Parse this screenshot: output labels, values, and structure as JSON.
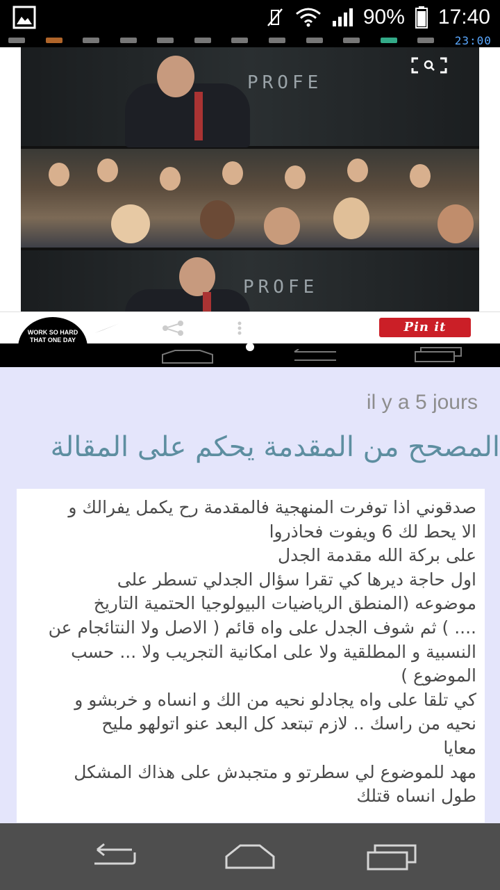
{
  "status_bar": {
    "battery": "90%",
    "time": "17:40"
  },
  "embedded_screenshot": {
    "inner_time": "23:00",
    "chalkboard_text_top": "PROFE",
    "chalkboard_text_bottom": "PROFE",
    "pin_label": "Pin it",
    "avatar_text": "WORK SO HARD THAT ONE DAY YOUR SIGNATURE WILL BE CALLED AN AUTOGRAPH.\""
  },
  "post": {
    "timestamp": "il y a 5 jours",
    "title": "المصحح من المقدمة يحكم على المقالة",
    "body": "صدقوني اذا توفرت المنهجية فالمقدمة رح يكمل يفرالك و\nالا يحط لك 6 ويفوت فحاذروا\nعلى بركة الله مقدمة الجدل\nاول حاجة ديرها كي تقرا سؤال الجدلي تسطر على\nموضوعه (المنطق الرياضيات البيولوجيا الحتمية التاريخ\n.... ) ثم شوف الجدل على واه قائم ( الاصل ولا النتائجام عن\nالنسبية و المطلقية ولا على امكانية التجريب ولا ... حسب\nالموضوع )\nكي تلقا على واه يجادلو نحيه من الك و انساه و خربشو و\nنحيه من راسك .. لازم تبتعد كل البعد عنو اتولهو مليح\nمعايا\nمهد للموضوع لي سطرتو و متجبدش على هذاك المشكل\nطول انساه قتلك"
  }
}
